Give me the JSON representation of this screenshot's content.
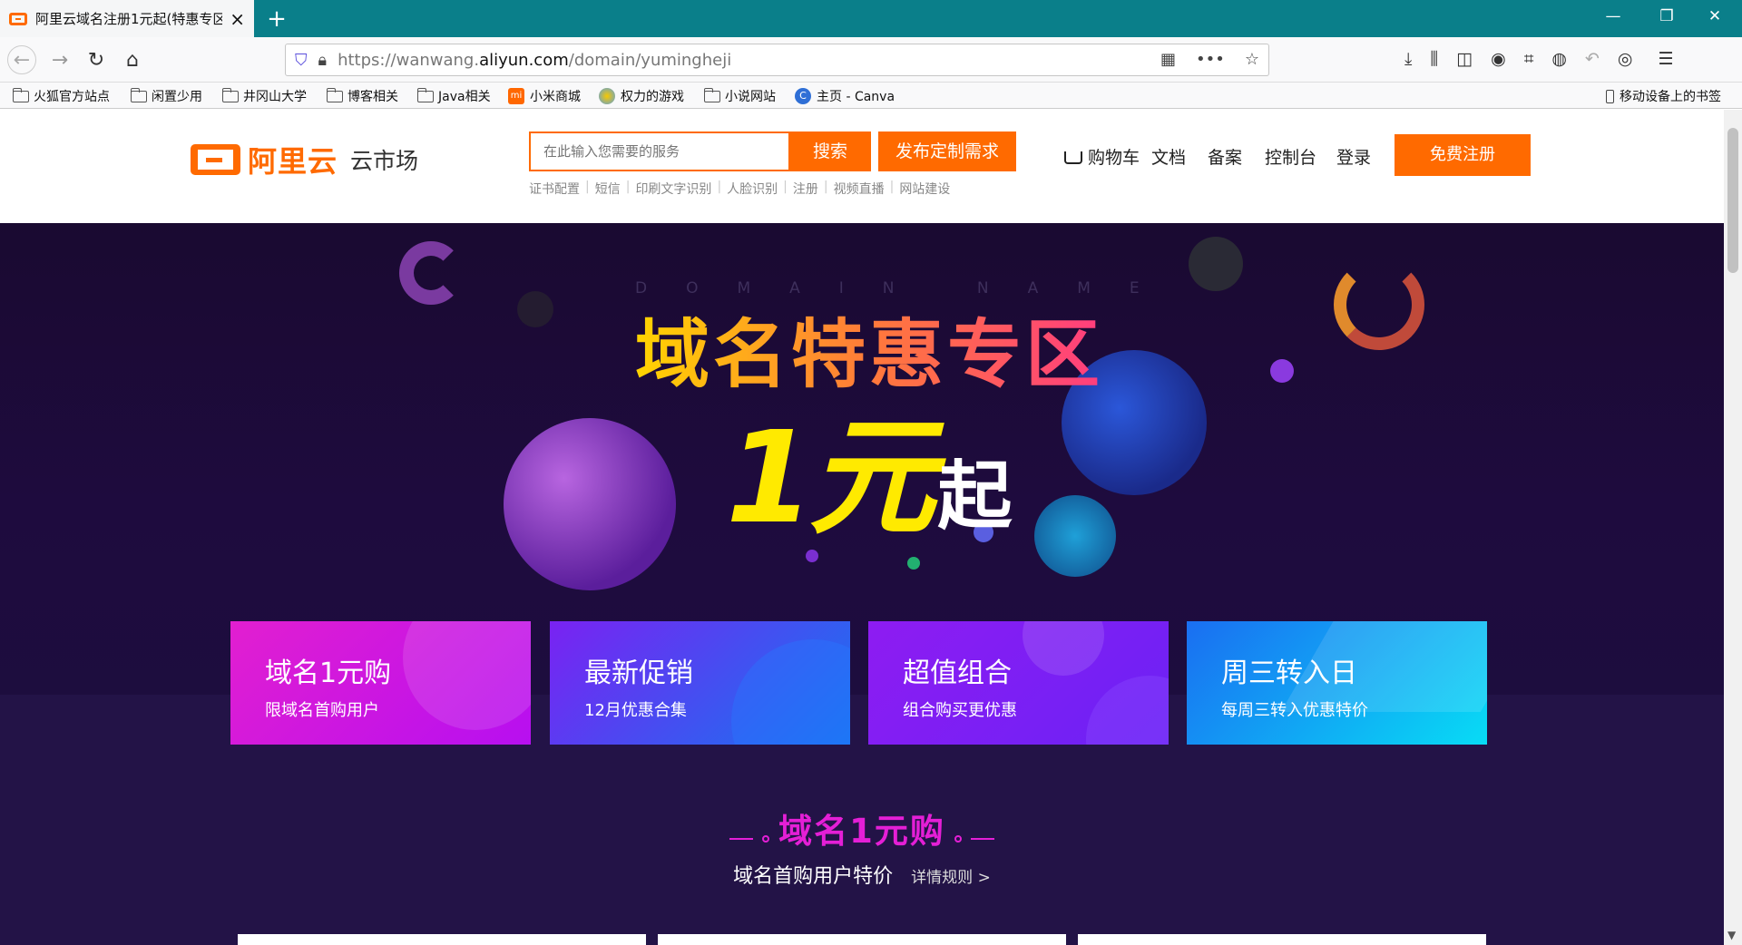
{
  "browser": {
    "tab_title": "阿里云域名注册1元起(特惠专区",
    "tab_close": "×",
    "new_tab": "+",
    "url_prefix": "https://wanwang.",
    "url_domain": "aliyun.com",
    "url_path": "/domain/yumingheji",
    "more_dots": "•••",
    "window": {
      "min": "—",
      "restore": "❐",
      "close": "✕"
    }
  },
  "bookmarks": [
    {
      "label": "火狐官方站点",
      "icon": "folder-icon"
    },
    {
      "label": "闲置少用",
      "icon": "folder-icon"
    },
    {
      "label": "井冈山大学",
      "icon": "folder-icon"
    },
    {
      "label": "博客相关",
      "icon": "folder-icon"
    },
    {
      "label": "Java相关",
      "icon": "folder-icon"
    },
    {
      "label": "小米商城",
      "icon": "mi-icon"
    },
    {
      "label": "权力的游戏",
      "icon": "game-icon"
    },
    {
      "label": "小说网站",
      "icon": "folder-icon"
    },
    {
      "label": "主页 - Canva",
      "icon": "canva-icon"
    }
  ],
  "mobile_bookmarks": "移动设备上的书签",
  "mi_text": "mi",
  "canva_text": "C",
  "header": {
    "brand": "阿里云",
    "brand_sub": "云市场",
    "search_placeholder": "在此输入您需要的服务",
    "search_button": "搜索",
    "custom_button": "发布定制需求",
    "hot_searches": [
      "证书配置",
      "短信",
      "印刷文字识别",
      "人脸识别",
      "注册",
      "视频直播",
      "网站建设"
    ],
    "nav": {
      "cart": "购物车",
      "docs": "文档",
      "beian": "备案",
      "console": "控制台",
      "login": "登录"
    },
    "register_button": "免费注册"
  },
  "hero": {
    "eyebrow": "DOMAIN NAME",
    "title": "域名特惠专区",
    "price_big": "1元",
    "price_suffix": "起"
  },
  "cards": [
    {
      "title": "域名1元购",
      "subtitle": "限域名首购用户",
      "gradient": [
        "#e21fd0",
        "#b70ff0"
      ]
    },
    {
      "title": "最新促销",
      "subtitle": "12月优惠合集",
      "gradient": [
        "#7a22f2",
        "#1576f0"
      ]
    },
    {
      "title": "超值组合",
      "subtitle": "组合购买更优惠",
      "gradient": [
        "#8e1cf2",
        "#6b22f5"
      ]
    },
    {
      "title": "周三转入日",
      "subtitle": "每周三转入优惠特价",
      "gradient": [
        "#1a6ef2",
        "#08dcf5"
      ]
    }
  ],
  "section": {
    "title": "域名1元购",
    "subtitle": "域名首购用户特价",
    "link": "详情规则 >"
  },
  "colors": {
    "accent": "#ff6a00",
    "section_title": "#e41fd6",
    "page_bg": "#1c0f3d"
  }
}
